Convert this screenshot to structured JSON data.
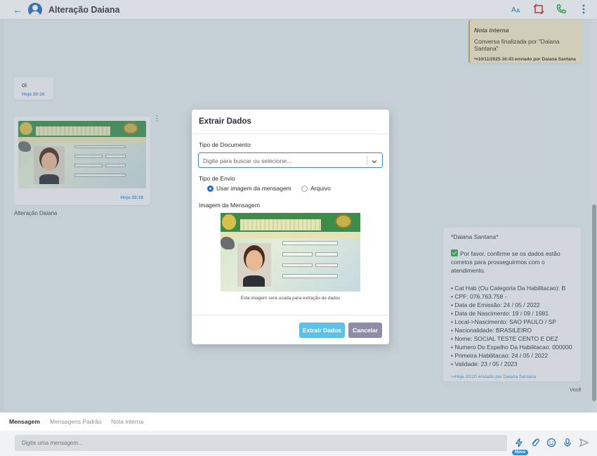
{
  "header": {
    "back_icon": "arrow-left-icon",
    "contact_name": "Alteração Daiana",
    "actions": [
      "translate-icon",
      "transfer-icon",
      "phone-icon",
      "more-vertical-icon"
    ]
  },
  "chat": {
    "note": {
      "title": "Nota interna",
      "body": "Conversa finalizada por \"Daiana Santana\"",
      "time": "10/11/2025 16:43 enviado por Daiana Santana"
    },
    "msg_oi": {
      "text": "oi",
      "time": "Hoje 20:16"
    },
    "image_msg": {
      "time": "Hoje 20:18",
      "sender": "Alteração Daiana"
    },
    "card": {
      "lines": [
        "*Daiana Santana*",
        "",
        "Por favor, confirme se os dados estão",
        "corretos para prosseguirmos com o",
        "atendimento.",
        "",
        "• Cat Hab (Ou Categoria Da Habilitacao): B",
        "• CPF: 076.763.758 -",
        "• Data de Emissão: 24 / 05 / 2022",
        "• Data de Nascimento: 19 / 09 / 1981",
        "• Local->Nascimento: SAO PAULO / SP",
        "• Nacionalidade: BRASILEIRO",
        "• Nome: SOCIAL TESTE CENTO E DEZ",
        "• Numero Do Espelho Da Habilitacao: 000000",
        "• Primeira Habilitacao: 24 / 05 / 2022",
        "• Validade: 23 / 05 / 2023"
      ],
      "time": "Hoje 20:20 enviado por Daiana Santana"
    },
    "you_label": "Você"
  },
  "modal": {
    "title": "Extrair Dados",
    "doc_type_label": "Tipo de Documento",
    "doc_type_placeholder": "Digite para buscar ou selecione...",
    "send_type_label": "Tipo de Envio",
    "radio_image": "Usar imagem da mensagem",
    "radio_file": "Arquivo",
    "radio_selected": "Usar imagem da mensagem",
    "image_label": "Imagem da Mensagem",
    "image_caption": "Esta imagem será usada para extração de dados",
    "extract_button": "Extrair Dados",
    "cancel_button": "Cancelar"
  },
  "tabs": [
    "Mensagem",
    "Mensagens Padrão",
    "Nota interna"
  ],
  "active_tab": "Mensagem",
  "composer": {
    "placeholder": "Digite uma mensagem...",
    "badge": "Novo"
  },
  "colors": {
    "accent": "#1f6bb5",
    "extract": "#5cc0e8",
    "cancel": "#8f8ca8",
    "note_bg": "#f3e9c7"
  }
}
